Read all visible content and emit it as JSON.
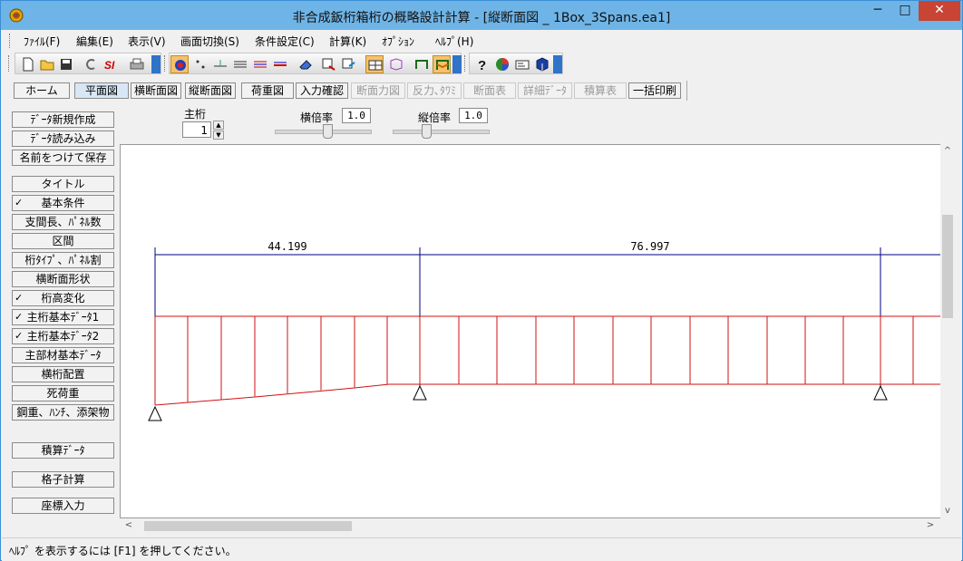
{
  "window": {
    "title": "非合成鈑桁箱桁の概略設計計算 - [縦断面図 _ 1Box_3Spans.ea1]",
    "min_glyph": "─",
    "max_glyph": "□",
    "close_glyph": "✕"
  },
  "menu": [
    "ﾌｧｲﾙ(F)",
    "編集(E)",
    "表示(V)",
    "画面切換(S)",
    "条件設定(C)",
    "計算(K)",
    "ｵﾌﾟｼｮﾝ",
    "ﾍﾙﾌﾟ(H)"
  ],
  "toolbar_icons": [
    "new-file-icon",
    "open-folder-icon",
    "save-icon",
    "undo-icon",
    "si-logo-icon",
    "print-icon",
    "draw-target-icon",
    "node-points-icon",
    "baseline-icon",
    "member-lines-icon",
    "sections-icon",
    "dimension-icon",
    "eraser-icon",
    "export-icon",
    "import-icon",
    "grid-view-icon",
    "3d-view-icon",
    "frame-icon",
    "color-frame-icon",
    "help-icon",
    "chart-icon",
    "id-card-icon",
    "cube-icon"
  ],
  "tabs": [
    {
      "label": "ホーム",
      "enabled": true
    },
    {
      "label": "平面図",
      "enabled": true
    },
    {
      "label": "横断面図",
      "enabled": true
    },
    {
      "label": "縦断面図",
      "enabled": true
    },
    {
      "label": "荷重図",
      "enabled": true
    },
    {
      "label": "入力確認",
      "enabled": true
    },
    {
      "label": "断面力図",
      "enabled": false
    },
    {
      "label": "反力､ﾀﾜﾐ",
      "enabled": false
    },
    {
      "label": "断面表",
      "enabled": false
    },
    {
      "label": "詳細ﾃﾞｰﾀ",
      "enabled": false
    },
    {
      "label": "積算表",
      "enabled": false
    },
    {
      "label": "一括印刷",
      "enabled": true
    }
  ],
  "left_buttons": [
    {
      "label": "ﾃﾞｰﾀ新規作成",
      "checked": false
    },
    {
      "label": "ﾃﾞｰﾀ読み込み",
      "checked": false
    },
    {
      "label": "名前をつけて保存",
      "checked": false
    },
    {
      "label": "タイトル",
      "checked": false
    },
    {
      "label": "基本条件",
      "checked": true
    },
    {
      "label": "支間長、ﾊﾟﾈﾙ数",
      "checked": false
    },
    {
      "label": "区間",
      "checked": false
    },
    {
      "label": "桁ﾀｲﾌﾟ、ﾊﾟﾈﾙ割",
      "checked": false
    },
    {
      "label": "横断面形状",
      "checked": false
    },
    {
      "label": "桁高変化",
      "checked": true
    },
    {
      "label": "主桁基本ﾃﾞｰﾀ1",
      "checked": true
    },
    {
      "label": "主桁基本ﾃﾞｰﾀ2",
      "checked": true
    },
    {
      "label": "主部材基本ﾃﾞｰﾀ",
      "checked": false
    },
    {
      "label": "横桁配置",
      "checked": false
    },
    {
      "label": "死荷重",
      "checked": false
    },
    {
      "label": "鋼重、ﾊﾝﾁ、添架物",
      "checked": false
    },
    {
      "label": "積算ﾃﾞｰﾀ",
      "checked": false
    },
    {
      "label": "格子計算",
      "checked": false
    },
    {
      "label": "座標入力",
      "checked": false
    }
  ],
  "check_glyph": "✓",
  "controls": {
    "girder_label": "主桁",
    "girder_value": "1",
    "spin_up": "▲",
    "spin_down": "▼",
    "hscale_label": "横倍率",
    "hscale_value": "1.0",
    "vscale_label": "縦倍率",
    "vscale_value": "1.0"
  },
  "drawing": {
    "span1": "44.199",
    "span2": "76.997"
  },
  "scroll": {
    "left": "<",
    "right": ">",
    "up": "^",
    "down": "v"
  },
  "status": "ﾍﾙﾌﾟ を表示するには [F1] を押してください。",
  "colors": {
    "girder_red": "#d01010",
    "dimension_blue": "#000080",
    "title_bar": "#6fb4e6",
    "close_button": "#c84434"
  }
}
